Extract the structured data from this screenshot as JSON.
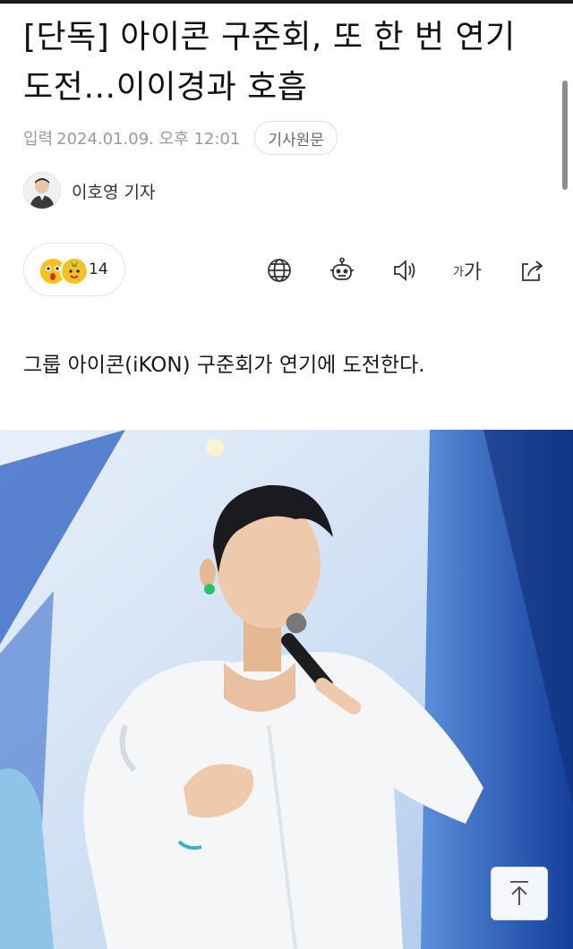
{
  "article": {
    "headline": "[단독] 아이콘 구준회, 또 한 번 연기도전…이이경과 호흡",
    "meta_label": "입력",
    "meta_date": "2024.01.09. 오후 12:01",
    "origin_button": "기사원문",
    "reporter": "이호영 기자",
    "lead": "그룹 아이콘(iKON) 구준회가 연기에 도전한다."
  },
  "reactions": {
    "count": "14",
    "emojis": [
      "surprised-emoji",
      "pineapple-emoji"
    ]
  },
  "toolbar": {
    "icons": [
      "globe-icon",
      "robot-summary-icon",
      "speaker-icon",
      "font-size-icon",
      "share-icon"
    ],
    "font_small": "가",
    "font_large": "가"
  },
  "colors": {
    "text": "#111111",
    "meta": "#9a9a9a",
    "border": "#e3e3e3",
    "photo_sky": "#d9e6f4",
    "photo_blue": "#2f66c9"
  }
}
